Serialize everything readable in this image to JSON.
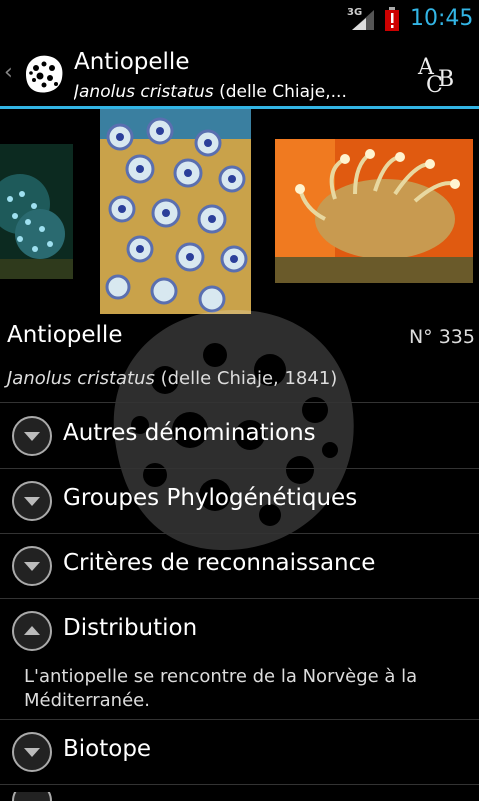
{
  "status_bar": {
    "network": "3G",
    "time": "10:45",
    "accent_color": "#33b5e5",
    "icons": [
      "signal-icon",
      "battery-alert-icon"
    ]
  },
  "action_bar": {
    "title": "Antiopelle",
    "subtitle_italic": "Janolus cristatus",
    "subtitle_rest": " (delle Chiaje,...",
    "abc_button": "ACB"
  },
  "species": {
    "name": "Antiopelle",
    "number": "N° 335",
    "scientific_italic": "Janolus cristatus",
    "scientific_rest": " (delle Chiaje, 1841)"
  },
  "sections": [
    {
      "label": "Autres dénominations",
      "expanded": false
    },
    {
      "label": "Groupes Phylogénétiques",
      "expanded": false
    },
    {
      "label": "Critères de reconnaissance",
      "expanded": false
    },
    {
      "label": "Distribution",
      "expanded": true
    },
    {
      "label": "Biotope",
      "expanded": false
    }
  ],
  "distribution_text": "L'antiopelle se rencontre de la Norvège à la Méditerranée."
}
